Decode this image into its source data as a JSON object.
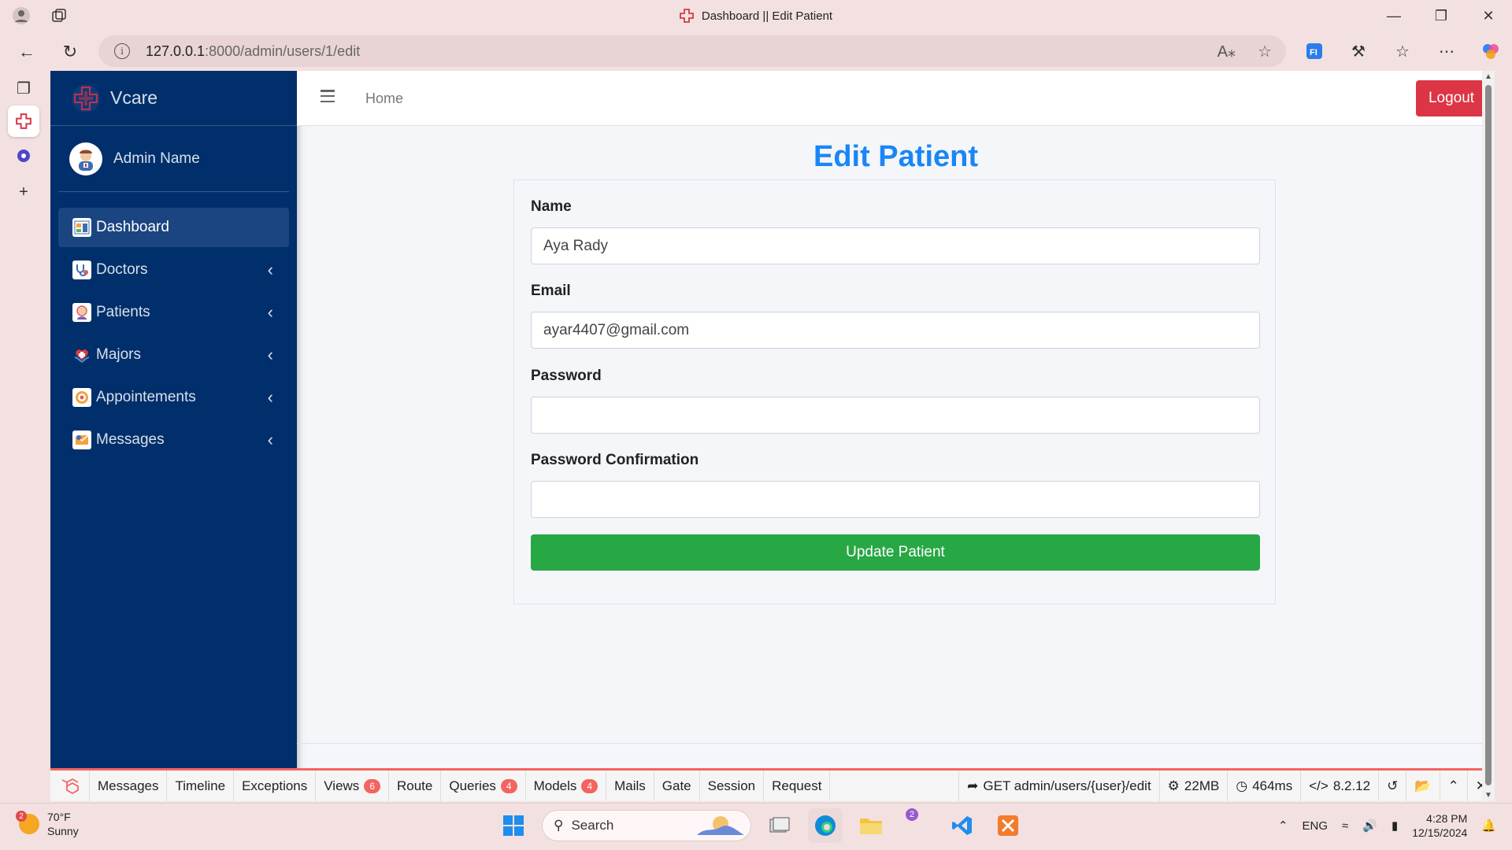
{
  "browser": {
    "tab_title": "Dashboard || Edit Patient",
    "url_host": "127.0.0.1",
    "url_path": ":8000/admin/users/1/edit"
  },
  "brand": {
    "name": "Vcare"
  },
  "user": {
    "name": "Admin Name"
  },
  "sidebar": {
    "items": [
      {
        "label": "Dashboard"
      },
      {
        "label": "Doctors"
      },
      {
        "label": "Patients"
      },
      {
        "label": "Majors"
      },
      {
        "label": "Appointements"
      },
      {
        "label": "Messages"
      }
    ]
  },
  "topnav": {
    "home": "Home",
    "logout": "Logout"
  },
  "form": {
    "title": "Edit Patient",
    "name_label": "Name",
    "name_value": "Aya Rady",
    "email_label": "Email",
    "email_value": "ayar4407@gmail.com",
    "password_label": "Password",
    "password_value": "",
    "confirm_label": "Password Confirmation",
    "confirm_value": "",
    "submit": "Update Patient"
  },
  "debugbar": {
    "tabs": [
      {
        "label": "Messages",
        "badge": ""
      },
      {
        "label": "Timeline",
        "badge": ""
      },
      {
        "label": "Exceptions",
        "badge": ""
      },
      {
        "label": "Views",
        "badge": "6"
      },
      {
        "label": "Route",
        "badge": ""
      },
      {
        "label": "Queries",
        "badge": "4"
      },
      {
        "label": "Models",
        "badge": "4"
      },
      {
        "label": "Mails",
        "badge": ""
      },
      {
        "label": "Gate",
        "badge": ""
      },
      {
        "label": "Session",
        "badge": ""
      },
      {
        "label": "Request",
        "badge": ""
      }
    ],
    "route": "GET admin/users/{user}/edit",
    "memory": "22MB",
    "time": "464ms",
    "php": "8.2.12"
  },
  "taskbar": {
    "temp": "70°F",
    "condition": "Sunny",
    "weather_badge": "2",
    "search": "Search",
    "teams_badge": "2",
    "lang": "ENG",
    "time": "4:28 PM",
    "date": "12/15/2024"
  }
}
